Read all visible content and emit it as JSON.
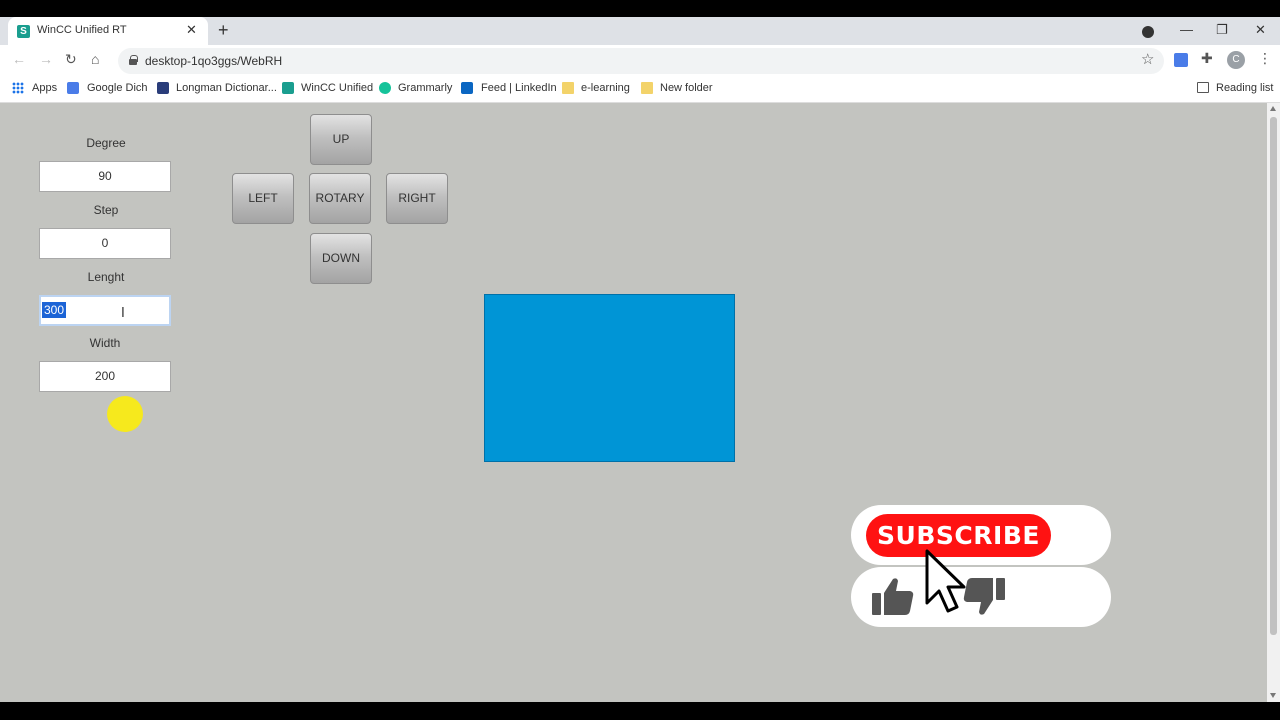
{
  "browser": {
    "tab_title": "WinCC Unified RT",
    "tab_favicon_letter": "S",
    "url": "desktop-1qo3ggs/WebRH",
    "avatar_letter": "C",
    "bookmarks": [
      "Apps",
      "Google Dich",
      "Longman Dictionar...",
      "WinCC Unified",
      "Grammarly",
      "Feed | LinkedIn",
      "e-learning",
      "New folder"
    ],
    "reading_list": "Reading list"
  },
  "form": {
    "degree_label": "Degree",
    "degree_value": "90",
    "step_label": "Step",
    "step_value": "0",
    "length_label": "Lenght",
    "length_value": "300",
    "width_label": "Width",
    "width_value": "200"
  },
  "pad": {
    "up": "UP",
    "left": "LEFT",
    "rotary": "ROTARY",
    "right": "RIGHT",
    "down": "DOWN"
  },
  "shape": {
    "color": "#0095d6"
  },
  "overlay": {
    "subscribe": "SUBSCRIBE",
    "subscribe_color": "#ff1212"
  }
}
